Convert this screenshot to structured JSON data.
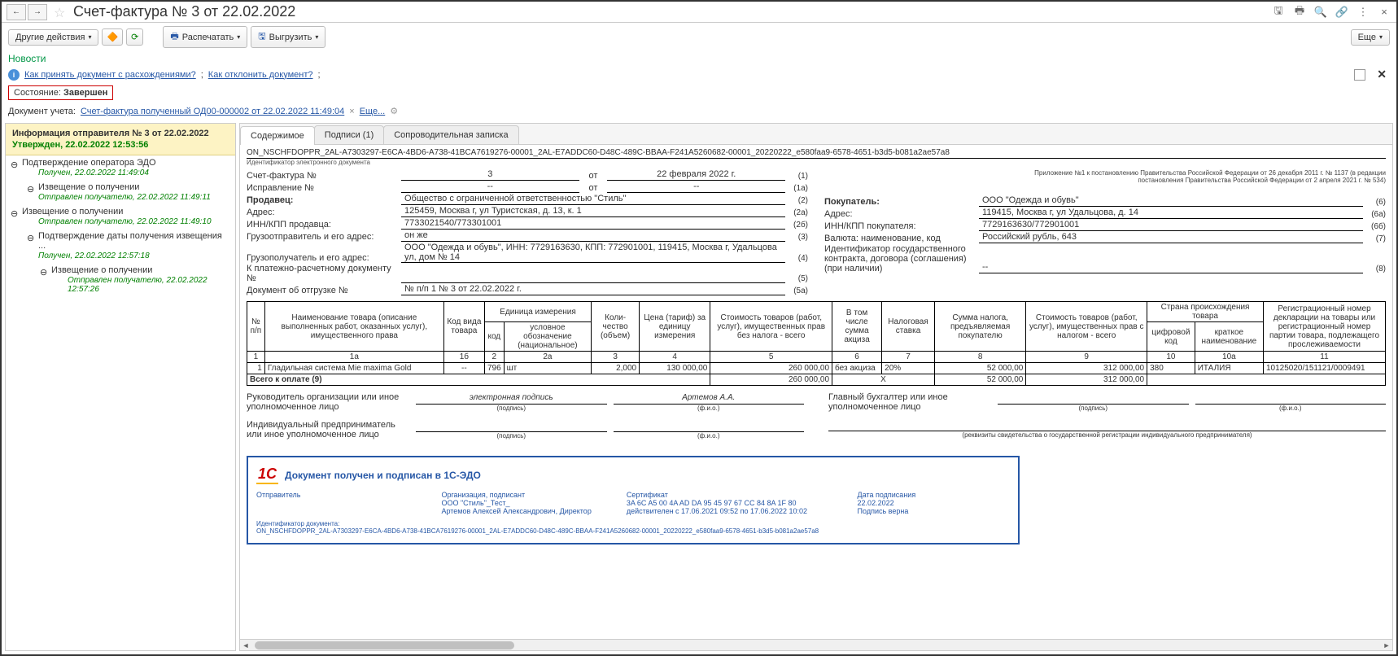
{
  "titlebar": {
    "title": "Счет-фактура № 3 от 22.02.2022"
  },
  "toolbar": {
    "other_actions": "Другие действия",
    "print": "Распечатать",
    "export": "Выгрузить",
    "more": "Еще"
  },
  "news_link": "Новости",
  "info_links": {
    "l1": "Как принять документ с расхождениями?",
    "l2": "Как отклонить документ?"
  },
  "status": {
    "label": "Состояние:",
    "value": "Завершен"
  },
  "doc_account": {
    "label": "Документ учета:",
    "link": "Счет-фактура полученный ОД00-000002 от 22.02.2022 11:49:04",
    "more": "Еще..."
  },
  "sidebar": {
    "header_title": "Информация отправителя № 3 от 22.02.2022",
    "header_sub": "Утвержден, 22.02.2022 12:53:56",
    "items": [
      {
        "lvl": 1,
        "title": "Подтверждение оператора ЭДО",
        "sub": "Получен, 22.02.2022 11:49:04"
      },
      {
        "lvl": 2,
        "title": "Извещение о получении",
        "sub": "Отправлен получателю, 22.02.2022 11:49:11"
      },
      {
        "lvl": 1,
        "title": "Извещение о получении",
        "sub": "Отправлен получателю, 22.02.2022 11:49:10"
      },
      {
        "lvl": 2,
        "title": "Подтверждение даты получения извещения ...",
        "sub": "Получен, 22.02.2022 12:57:18"
      },
      {
        "lvl": 3,
        "title": "Извещение о получении",
        "sub": "Отправлен получателю, 22.02.2022 12:57:26"
      }
    ]
  },
  "tabs": [
    "Содержимое",
    "Подписи (1)",
    "Сопроводительная записка"
  ],
  "doc": {
    "file_id": "ON_NSCHFDOPPR_2AL-A7303297-E6CA-4BD6-A738-41BCA7619276-00001_2AL-E7ADDC60-D48C-489C-BBAA-F241A5260682-00001_20220222_e580faa9-6578-4651-b3d5-b081a2ae57a8",
    "file_id_label": "Идентификатор электронного документа",
    "note_right": "Приложение №1 к постановлению Правительства Российской Федерации от 26 декабря 2011 г. № 1137 (в редакции постановления Правительства Российской Федерации от 2 апреля 2021 г. № 534)",
    "rows_left": [
      {
        "label": "Счет-фактура №",
        "v1": "3",
        "mid": "от",
        "v2": "22 февраля 2022 г.",
        "p": "(1)"
      },
      {
        "label": "Исправление №",
        "v1": "--",
        "mid": "от",
        "v2": "--",
        "p": "(1а)"
      },
      {
        "label": "Продавец:",
        "v": "Общество с ограниченной ответственностью \"Стиль\"",
        "p": "(2)",
        "bold": true
      },
      {
        "label": "Адрес:",
        "v": "125459, Москва г, ул Туристская, д. 13, к. 1",
        "p": "(2а)"
      },
      {
        "label": "ИНН/КПП продавца:",
        "v": "7733021540/773301001",
        "p": "(2б)"
      },
      {
        "label": "Грузоотправитель и его адрес:",
        "v": "он же",
        "p": "(3)"
      },
      {
        "label": "Грузополучатель и его адрес:",
        "v": "ООО \"Одежда и обувь\", ИНН: 7729163630, КПП: 772901001, 119415, Москва г, Удальцова ул, дом № 14",
        "p": "(4)"
      },
      {
        "label": "К платежно-расчетному документу №",
        "v": "",
        "p": "(5)"
      },
      {
        "label": "Документ об отгрузке №",
        "v": "№ п/п 1 № 3 от 22.02.2022 г.",
        "p": "(5а)"
      }
    ],
    "rows_right": [
      {
        "label": "Покупатель:",
        "v": "ООО \"Одежда и обувь\"",
        "p": "(6)",
        "bold": true
      },
      {
        "label": "Адрес:",
        "v": "119415, Москва г, ул Удальцова, д. 14",
        "p": "(6а)"
      },
      {
        "label": "ИНН/КПП покупателя:",
        "v": "7729163630/772901001",
        "p": "(6б)"
      },
      {
        "label": "Валюта: наименование, код",
        "v": "Российский рубль, 643",
        "p": "(7)"
      },
      {
        "label": "Идентификатор государственного контракта, договора (соглашения) (при наличии)",
        "v": "--",
        "p": "(8)"
      }
    ],
    "table": {
      "headers": {
        "c1": "№ п/п",
        "c1a": "Наименование товара (описание выполненных работ, оказанных услуг), имущественного права",
        "c1b": "Код вида товара",
        "c2h": "Единица измерения",
        "c2": "код",
        "c2a": "условное обозначение (национальное)",
        "c3": "Коли- чество (объем)",
        "c4": "Цена (тариф) за единицу измерения",
        "c5": "Стоимость товаров (работ, услуг), имущественных прав без налога - всего",
        "c6": "В том числе сумма акциза",
        "c7": "Налоговая ставка",
        "c8": "Сумма налога, предъявляемая покупателю",
        "c9": "Стоимость товаров (работ, услуг), имущественных прав с налогом - всего",
        "c10h": "Страна происхождения товара",
        "c10": "цифровой код",
        "c10a": "краткое наименование",
        "c11": "Регистрационный номер декларации на товары или регистрационный номер партии товара, подлежащего прослеживаемости"
      },
      "nums": [
        "1",
        "1а",
        "1б",
        "2",
        "2а",
        "3",
        "4",
        "5",
        "6",
        "7",
        "8",
        "9",
        "10",
        "10а",
        "11"
      ],
      "row": {
        "n": "1",
        "name": "Гладильная система Mie maxima Gold",
        "code": "--",
        "ucode": "796",
        "uname": "шт",
        "qty": "2,000",
        "price": "130 000,00",
        "sum_no_tax": "260 000,00",
        "excise": "без акциза",
        "rate": "20%",
        "tax": "52 000,00",
        "sum_tax": "312 000,00",
        "ccode": "380",
        "cname": "ИТАЛИЯ",
        "decl": "10125020/151121/0009491"
      },
      "total_label": "Всего к оплате (9)",
      "total": {
        "sum_no_tax": "260 000,00",
        "x": "X",
        "tax": "52 000,00",
        "sum_tax": "312 000,00"
      }
    },
    "sign": {
      "left_label": "Руководитель организации или иное уполномоченное лицо",
      "sig_text": "электронная подпись",
      "name": "Артемов А.А.",
      "right_label": "Главный бухгалтер или иное уполномоченное лицо",
      "bottom_label": "Индивидуальный предприниматель или иное уполномоченное лицо",
      "sub_sig": "(подпись)",
      "sub_fio": "(ф.и.о.)",
      "sub_req": "(реквизиты свидетельства о государственной регистрации индивидуального предпринимателя)"
    },
    "edo": {
      "title": "Документ получен и подписан в 1С-ЭДО",
      "org_l": "Организация, подписант",
      "org_v1": "ООО \"Стиль\"_Тест_",
      "org_v2": "Артемов Алексей Александрович, Директор",
      "cert_l": "Сертификат",
      "cert_v1": "3A 6C A5 00 4A AD DA 95 45 97 67 CC 84 8A 1F 80",
      "cert_v2": "действителен с 17.06.2021 09:52 по 17.06.2022 10:02",
      "date_l": "Дата подписания",
      "date_v": "22.02.2022",
      "verify": "Подпись верна",
      "sender_l": "Отправитель",
      "docid_l": "Идентификатор документа:",
      "docid_v": "ON_NSCHFDOPPR_2AL-A7303297-E6CA-4BD6-A738-41BCA7619276-00001_2AL-E7ADDC60-D48C-489C-BBAA-F241A5260682-00001_20220222_e580faa9-6578-4651-b3d5-b081a2ae57a8"
    }
  }
}
